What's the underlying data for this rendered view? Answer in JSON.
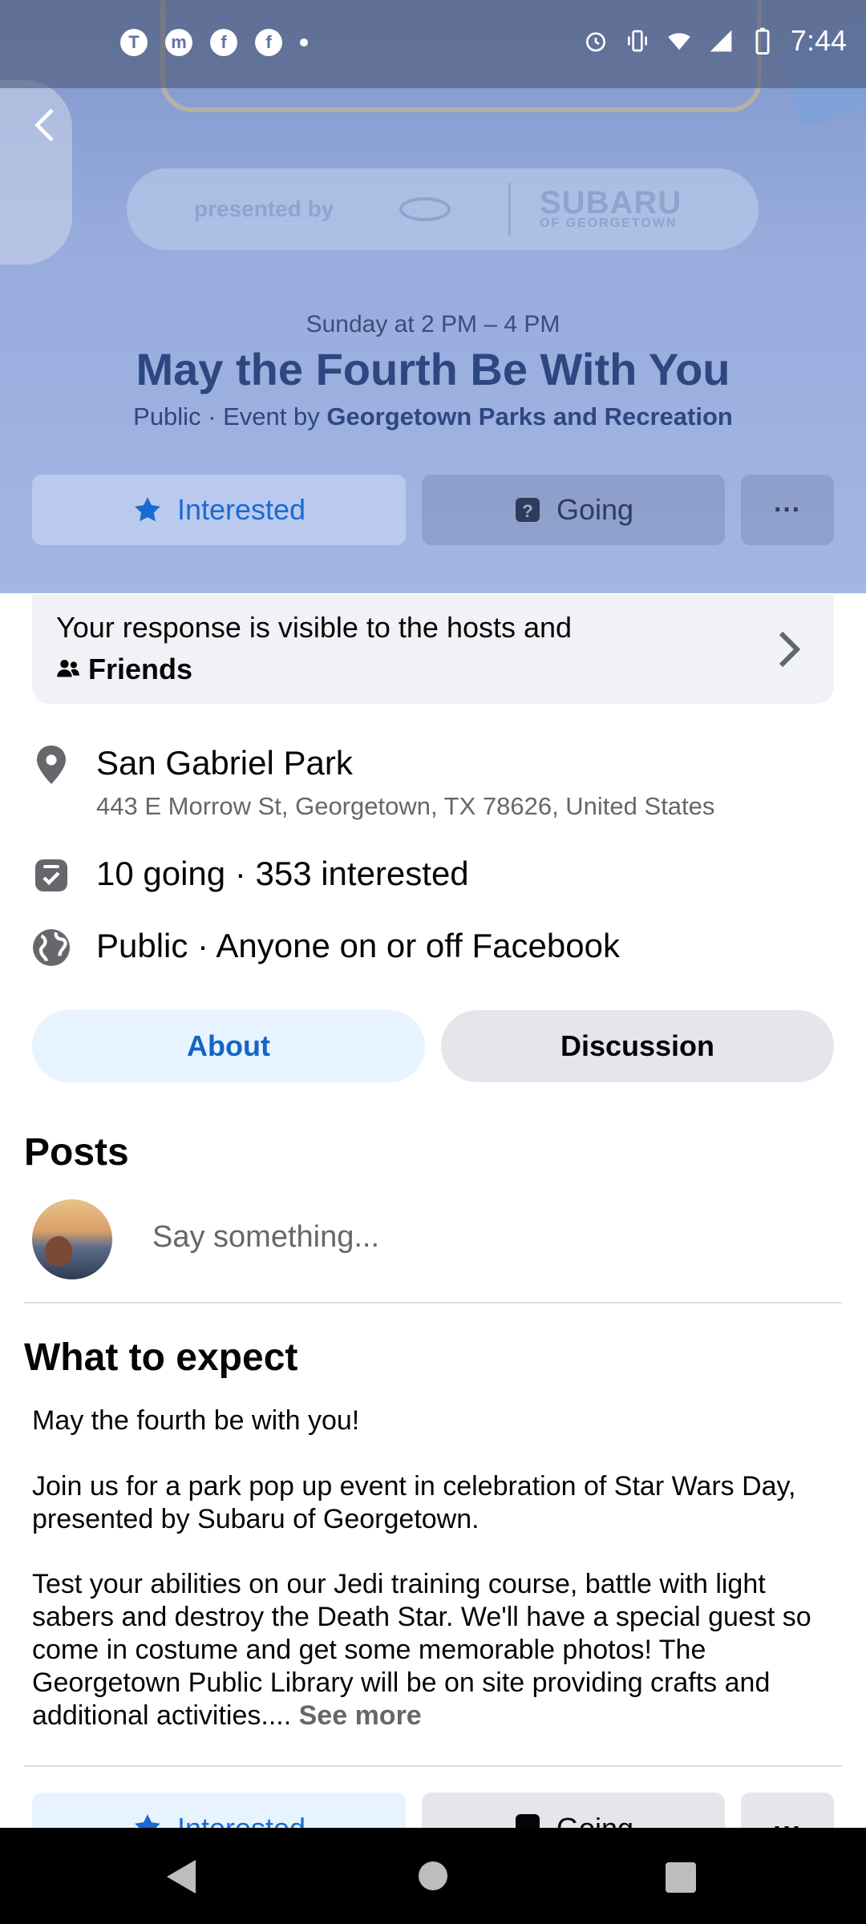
{
  "status_bar": {
    "time": "7:44",
    "left_icons": [
      "teams-icon",
      "messenger-icon",
      "facebook-icon",
      "facebook-icon"
    ],
    "right_icons": [
      "alarm-icon",
      "vibrate-icon",
      "wifi-icon",
      "signal-icon",
      "battery-icon"
    ]
  },
  "cover": {
    "presented_by": "presented by",
    "brand_name": "SUBARU",
    "brand_sub": "OF GEORGETOWN"
  },
  "event": {
    "when": "Sunday at 2 PM – 4 PM",
    "title": "May the Fourth Be With You",
    "privacy_prefix": "Public · Event by ",
    "host": "Georgetown Parks and Recreation"
  },
  "rsvp": {
    "interested": "Interested",
    "going": "Going",
    "more": "···"
  },
  "response_notice": {
    "line1": "Your response is visible to the hosts and",
    "audience": "Friends"
  },
  "details": {
    "location_name": "San Gabriel Park",
    "location_address": "443 E Morrow St, Georgetown, TX 78626, United States",
    "attendance": "10 going · 353 interested",
    "visibility": "Public · Anyone on or off Facebook"
  },
  "tabs": {
    "about": "About",
    "discussion": "Discussion"
  },
  "posts": {
    "heading": "Posts",
    "composer_placeholder": "Say something..."
  },
  "expect": {
    "heading": "What to expect",
    "p1": "May the fourth be with you!",
    "p2": "Join us for a park pop up event in celebration of Star Wars Day, presented by Subaru of Georgetown.",
    "p3": "Test your abilities on our Jedi training course, battle with light sabers and destroy the Death Star. We'll have a special guest so come in costume and get some memorable photos! The Georgetown Public Library will be on site providing crafts and additional activities....",
    "see_more": "See more"
  },
  "bottom_rsvp": {
    "interested": "Interested",
    "going": "Going",
    "more": "···"
  }
}
